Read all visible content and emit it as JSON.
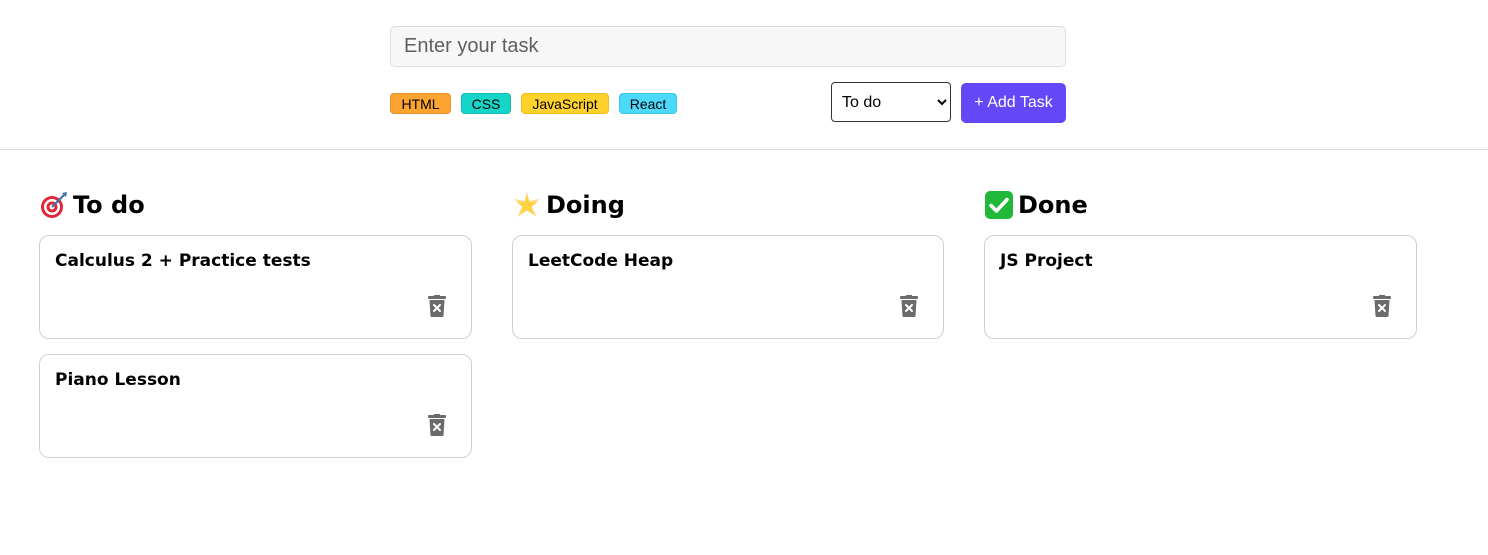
{
  "form": {
    "task_placeholder": "Enter your task",
    "tags": [
      {
        "label": "HTML",
        "color": "#fda430"
      },
      {
        "label": "CSS",
        "color": "#15d4c8"
      },
      {
        "label": "JavaScript",
        "color": "#ffd12c"
      },
      {
        "label": "React",
        "color": "#4cdafc"
      }
    ],
    "status_selected": "To do",
    "add_button_label": "+ Add Task",
    "accent_color": "#6447f7"
  },
  "columns": [
    {
      "title": "To do",
      "icon": "dart-target-icon",
      "cards": [
        {
          "title": "Calculus 2 + Practice tests"
        },
        {
          "title": "Piano Lesson"
        }
      ]
    },
    {
      "title": "Doing",
      "icon": "glowing-star-icon",
      "cards": [
        {
          "title": "LeetCode Heap"
        }
      ]
    },
    {
      "title": "Done",
      "icon": "check-mark-icon",
      "cards": [
        {
          "title": "JS Project"
        }
      ]
    }
  ]
}
